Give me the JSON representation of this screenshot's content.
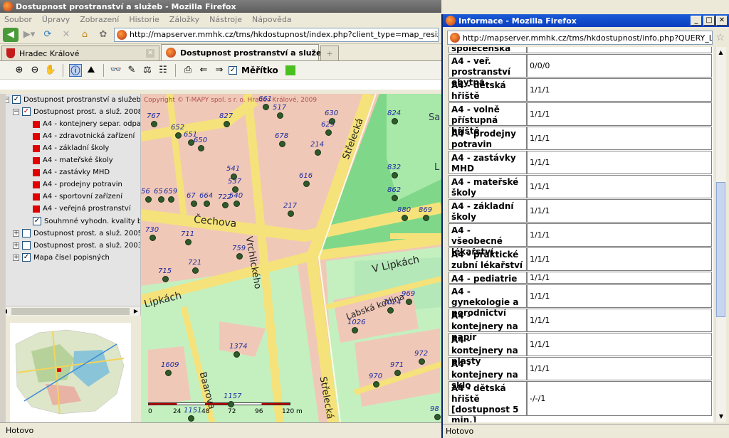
{
  "main": {
    "title": "Dostupnost prostranství a služeb - Mozilla Firefox",
    "menu": [
      "Soubor",
      "Úpravy",
      "Zobrazení",
      "Historie",
      "Záložky",
      "Nástroje",
      "Nápověda"
    ],
    "url": "http://mapserver.mmhk.cz/tms/hkdostupnost/index.php?client_type=map_resize&strange_open",
    "tabs": [
      {
        "label": "Hradec Králové",
        "active": false
      },
      {
        "label": "Dostupnost prostranství a služeb",
        "active": true
      }
    ],
    "map_toolbar": {
      "scale_label": "Měřítko",
      "scale_checked": true
    },
    "status": "Hotovo"
  },
  "layers": {
    "root": "Dostupnost prostranství a služeb",
    "group2008": "Dostupnost prost. a služ. 2008",
    "items": [
      "A4 - kontejnery separ. odpadu",
      "A4 - zdravotnická zařízení",
      "A4 - základní školy",
      "A4 - mateřské školy",
      "A4 - zastávky MHD",
      "A4 - prodejny potravin",
      "A4 - sportovní zařízení",
      "A4 - veřejná prostranství"
    ],
    "summary": "Souhrnné vyhodn. kvality bydl.",
    "group2005": "Dostupnost prost. a služ. 2005",
    "group2003": "Dostupnost prost. a služ. 2003",
    "numbers": "Mapa čísel popisných"
  },
  "map": {
    "copyright": "Copyright © T-MAPY spol. s r. o. Hradec Králové, 2009",
    "streets": [
      "Čechova",
      "Vrchlického",
      "Střelecká",
      "V Lipkách",
      "Labská kotlina",
      "Lipkách",
      "Baarova",
      "Střelecká"
    ],
    "labels_partial": [
      "Sa",
      "L"
    ],
    "house_numbers": [
      "661",
      "517",
      "630",
      "824",
      "767",
      "827",
      "652",
      "651",
      "650",
      "629",
      "678",
      "214",
      "832",
      "541",
      "616",
      "537",
      "862",
      "56",
      "65",
      "659",
      "67",
      "664",
      "722",
      "540",
      "217",
      "880",
      "869",
      "730",
      "711",
      "759",
      "721",
      "715",
      "1024",
      "969",
      "1026",
      "1374",
      "972",
      "1609",
      "971",
      "970",
      "1157",
      "1151",
      "98"
    ],
    "scale_ticks": [
      "0",
      "24",
      "48",
      "72",
      "96",
      "120 m"
    ]
  },
  "info": {
    "title": "Informace - Mozilla Firefox",
    "url": "http://mapserver.mmhk.cz/tms/hkdostupnost/info.php?QUERY_LAYERS=dost_v",
    "rows": [
      {
        "label": "společenská",
        "value": ""
      },
      {
        "label": "A4 - veř. prostranství obytná",
        "value": "0/0/0"
      },
      {
        "label": "A4 - dětská hřiště",
        "value": "1/1/1"
      },
      {
        "label": "A4 - volně přístupná hřiště",
        "value": "1/1/1"
      },
      {
        "label": "A4 - prodejny potravin",
        "value": "1/1/1"
      },
      {
        "label": "A4 - zastávky MHD",
        "value": "1/1/1"
      },
      {
        "label": "A4 - mateřské školy",
        "value": "1/1/1"
      },
      {
        "label": "A4 - základní školy",
        "value": "1/1/1"
      },
      {
        "label": "A4 - všeobecné lékařství",
        "value": "1/1/1"
      },
      {
        "label": "A4 - praktické zubní lékařství",
        "value": "1/1/1"
      },
      {
        "label": "A4 - pediatrie",
        "value": "1/1/1"
      },
      {
        "label": "A4 - gynekologie a porodnictví",
        "value": "1/1/1"
      },
      {
        "label": "A4 - kontejnery na papír",
        "value": "1/1/1"
      },
      {
        "label": "A4 - kontejnery na plasty",
        "value": "1/1/1"
      },
      {
        "label": "A4 - kontejnery na sklo",
        "value": "1/1/1"
      },
      {
        "label": "A4 - dětská hřiště [dostupnost 5 min.]",
        "value": "-/-/1"
      }
    ],
    "status": "Hotovo"
  }
}
